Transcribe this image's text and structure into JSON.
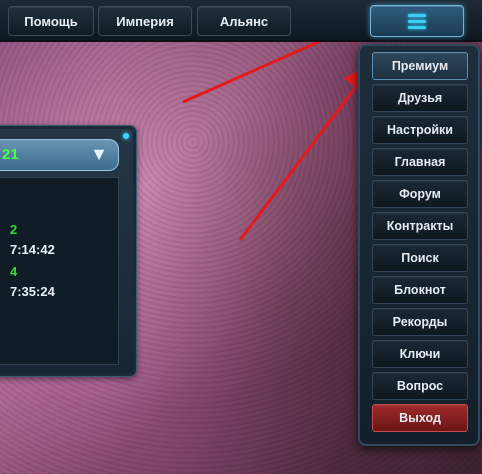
{
  "topbar": {
    "buttons": [
      "Помощь",
      "Империя",
      "Альянс"
    ],
    "menu_icon": "hamburger-icon"
  },
  "panel": {
    "header_value": "21",
    "header_icon": "chevron-down-icon",
    "lines": [
      {
        "text": "2",
        "color": "green"
      },
      {
        "text": "7:14:42",
        "color": "white"
      },
      {
        "text": "4",
        "color": "green"
      },
      {
        "text": "7:35:24",
        "color": "white"
      }
    ]
  },
  "menu": {
    "items": [
      "Премиум",
      "Друзья",
      "Настройки",
      "Главная",
      "Форум",
      "Контракты",
      "Поиск",
      "Блокнот",
      "Рекорды",
      "Ключи",
      "Вопрос",
      "Выход"
    ]
  },
  "colors": {
    "accent": "#36d0f5",
    "exit": "#9e2a2a",
    "timer_green": "#33dd33",
    "annotation_arrow": "#e41a1a"
  }
}
